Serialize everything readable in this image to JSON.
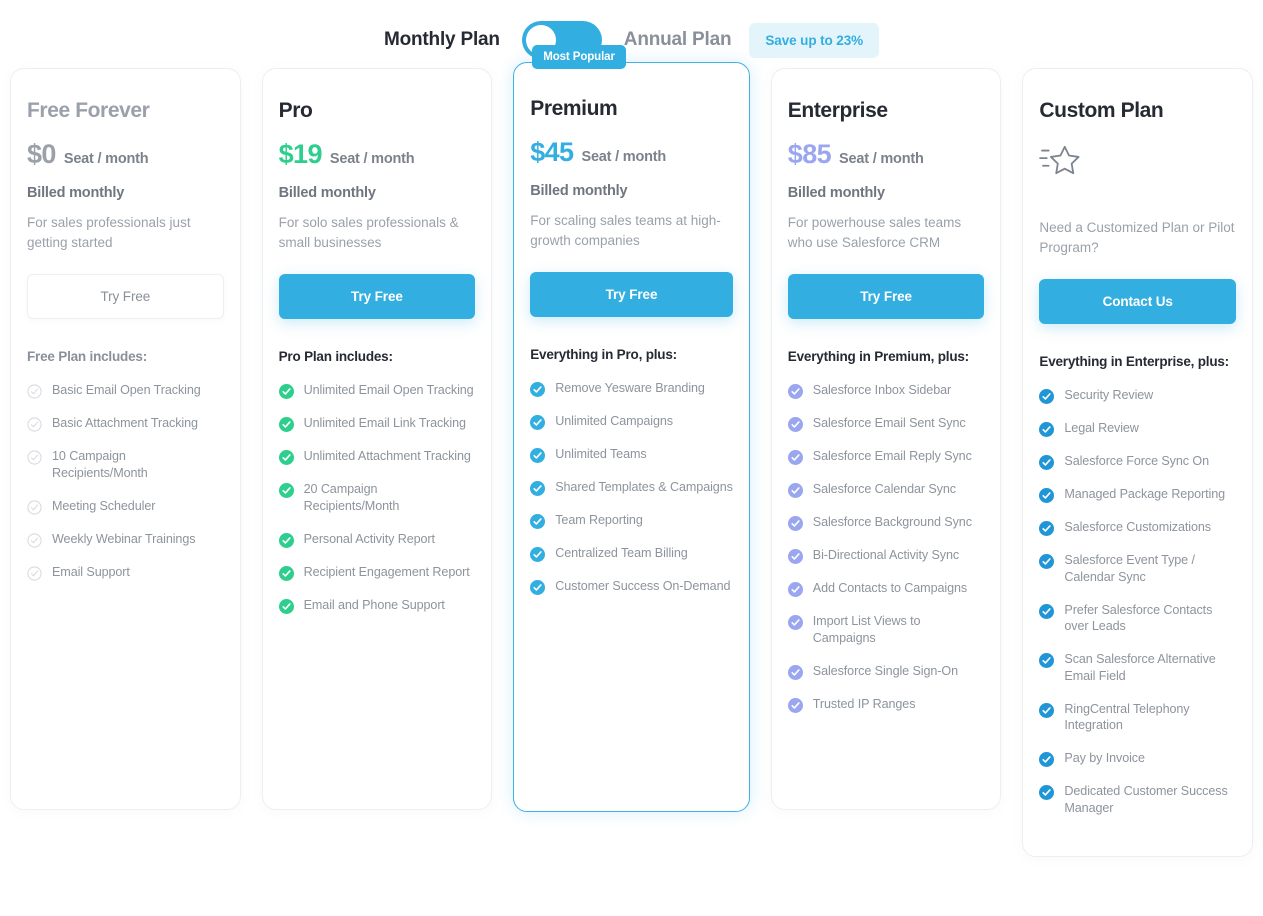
{
  "billing_toggle": {
    "monthly_label": "Monthly Plan",
    "annual_label": "Annual Plan",
    "save_badge": "Save up to 23%",
    "selected": "Monthly Plan",
    "accent_color": "#32aee0",
    "badge_bg": "#e4f4fb"
  },
  "badges": {
    "most_popular": "Most Popular"
  },
  "plans": [
    {
      "name": "Free Forever",
      "price": "$0",
      "price_color": "#9aa1aa",
      "price_unit": "Seat / month",
      "billed": "Billed monthly",
      "blurb": "For sales professionals just getting started",
      "cta_label": "Try Free",
      "cta_style": "ghost",
      "includes_title": "Free Plan includes:",
      "check_color": "#d6dadf",
      "check_style": "outline",
      "features": [
        "Basic Email Open Tracking",
        "Basic Attachment Tracking",
        "10 Campaign Recipients/Month",
        "Meeting Scheduler",
        "Weekly Webinar Trainings",
        "Email Support"
      ]
    },
    {
      "name": "Pro",
      "price": "$19",
      "price_color": "#2ecf8e",
      "price_unit": "Seat / month",
      "billed": "Billed monthly",
      "blurb": "For solo sales professionals & small businesses",
      "cta_label": "Try Free",
      "cta_style": "primary",
      "includes_title": "Pro Plan includes:",
      "check_color": "#2ecf8e",
      "check_style": "filled",
      "features": [
        "Unlimited Email Open Tracking",
        "Unlimited Email Link Tracking",
        "Unlimited Attachment Tracking",
        "20 Campaign Recipients/Month",
        "Personal Activity Report",
        "Recipient Engagement Report",
        "Email and Phone Support"
      ]
    },
    {
      "name": "Premium",
      "price": "$45",
      "price_color": "#32aee0",
      "price_unit": "Seat / month",
      "billed": "Billed monthly",
      "blurb": "For scaling sales teams at high-growth companies",
      "cta_label": "Try Free",
      "cta_style": "primary",
      "includes_title": "Everything in Pro, plus:",
      "check_color": "#32aee0",
      "check_style": "filled",
      "featured": true,
      "features": [
        "Remove Yesware Branding",
        "Unlimited Campaigns",
        "Unlimited Teams",
        "Shared Templates & Campaigns",
        "Team Reporting",
        "Centralized Team Billing",
        "Customer Success On-Demand"
      ]
    },
    {
      "name": "Enterprise",
      "price": "$85",
      "price_color": "#9aa6f0",
      "price_unit": "Seat / month",
      "billed": "Billed monthly",
      "blurb": "For powerhouse sales teams who use Salesforce CRM",
      "cta_label": "Try Free",
      "cta_style": "primary",
      "includes_title": "Everything in Premium, plus:",
      "check_color": "#9aa6f0",
      "check_style": "filled",
      "features": [
        "Salesforce Inbox Sidebar",
        "Salesforce Email Sent Sync",
        "Salesforce Email Reply Sync",
        "Salesforce Calendar Sync",
        "Salesforce Background Sync",
        "Bi-Directional Activity Sync",
        "Add Contacts to Campaigns",
        "Import List Views to Campaigns",
        "Salesforce Single Sign-On",
        "Trusted IP Ranges"
      ]
    },
    {
      "name": "Custom Plan",
      "price": "",
      "price_color": "#262a33",
      "price_unit": "",
      "billed": "",
      "blurb": "Need a Customized Plan or Pilot Program?",
      "cta_label": "Contact Us",
      "cta_style": "primary",
      "includes_title": "Everything in Enterprise, plus:",
      "check_color": "#2196d6",
      "check_style": "filled",
      "icon": "shooting-star-icon",
      "features": [
        "Security Review",
        "Legal Review",
        "Salesforce Force Sync On",
        "Managed Package Reporting",
        "Salesforce Customizations",
        "Salesforce Event Type / Calendar Sync",
        "Prefer Salesforce Contacts over Leads",
        "Scan Salesforce Alternative Email Field",
        "RingCentral Telephony Integration",
        "Pay by Invoice",
        "Dedicated Customer Success Manager"
      ]
    }
  ]
}
